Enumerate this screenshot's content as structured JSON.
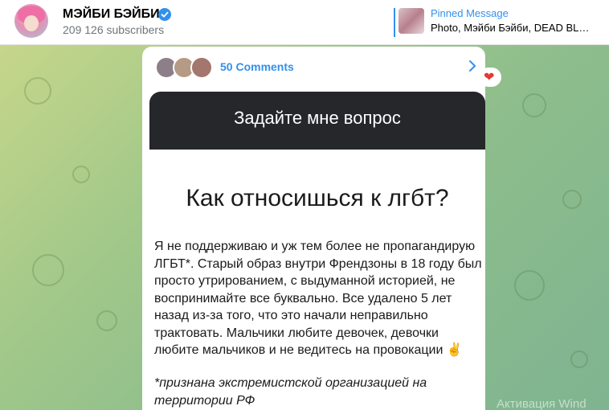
{
  "header": {
    "channel_name": "МЭЙБИ БЭЙБИ",
    "subscribers": "209 126 subscribers",
    "verified_icon": "verified-check-icon"
  },
  "pinned": {
    "title": "Pinned Message",
    "preview": "Photo, Мэйби Бэйби, DEAD BL…"
  },
  "post": {
    "comments_label": "50 Comments",
    "reaction": "❤",
    "story_header": "Задайте мне вопрос",
    "question": "Как относишься к лгбт?",
    "answer": "Я не поддерживаю и уж тем более не пропагандирую ЛГБТ*. Старый образ внутри Френдзоны в 18 году был просто утрированием, с выдуманной историей, не воспринимайте все буквально. Все удалено 5 лет назад из-за того, что это начали неправильно трактовать. Мальчики любите девочек, девочки любите мальчиков и не ведитесь на провокации ✌",
    "note": "*признана экстремистской организацией на территории РФ"
  },
  "watermark": "Активация Wind",
  "colors": {
    "accent": "#3390ec",
    "story_header_bg": "#25272b",
    "chat_bg_start": "#c6d68a",
    "chat_bg_end": "#7fb491"
  }
}
